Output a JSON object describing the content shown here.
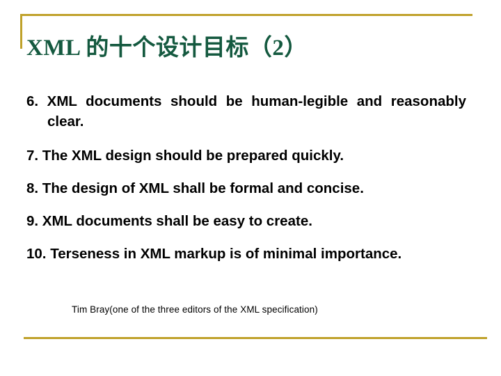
{
  "slide": {
    "title": "XML 的十个设计目标（2）",
    "accent_color": "#BFA12A",
    "title_color": "#14593F",
    "body_color": "#000000",
    "background_color": "#FFFFFF",
    "goals": [
      {
        "number": "6.",
        "text": "6.  XML  documents  should  be  human-legible  and reasonably clear."
      },
      {
        "number": "7.",
        "text": "7. The XML design should be prepared quickly."
      },
      {
        "number": "8.",
        "text": "8. The design of XML shall be formal and concise."
      },
      {
        "number": "9.",
        "text": "9. XML documents shall be easy to create."
      },
      {
        "number": "10.",
        "text": "10. Terseness in XML markup is of minimal importance."
      }
    ],
    "attribution": "Tim Bray(one of the three editors of the XML specification)"
  }
}
